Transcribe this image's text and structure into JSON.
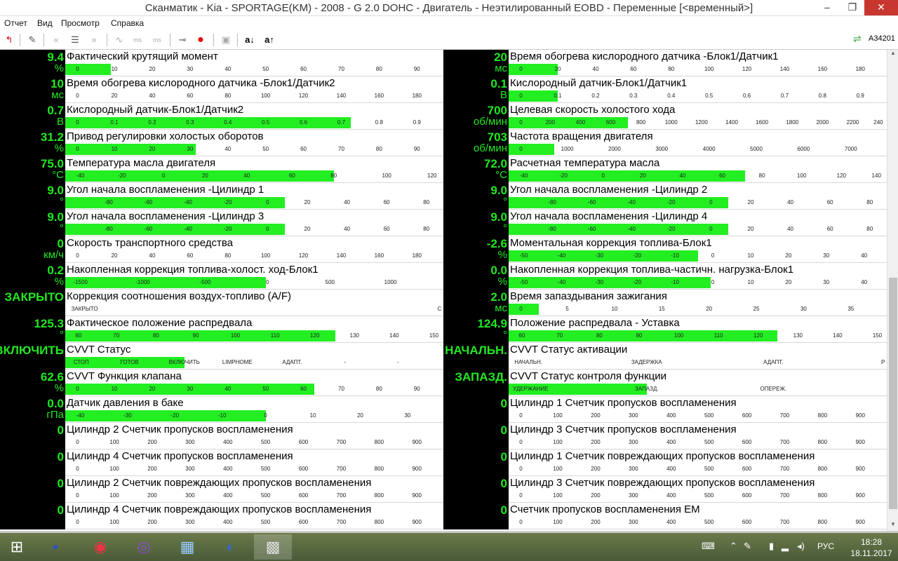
{
  "window": {
    "title": "Сканматик - Kia - SPORTAGE(KM) - 2008 - G 2.0 DOHC - Двигатель - Неэтилированный EOBD - Переменные [<временный>]",
    "min": "–",
    "max": "❐",
    "close": "✕"
  },
  "menu": [
    "Отчет",
    "Вид",
    "Просмотр",
    "Справка"
  ],
  "toolbar": {
    "device_id": "A34201"
  },
  "left": [
    {
      "value": "9.4",
      "unit": "%",
      "label": "Фактический крутящий момент",
      "fill": 0.12,
      "ticks": [
        "0",
        "10",
        "20",
        "30",
        "40",
        "50",
        "60",
        "70",
        "80",
        "90"
      ],
      "tickpos": [
        0.03,
        0.13,
        0.23,
        0.33,
        0.43,
        0.53,
        0.63,
        0.73,
        0.83,
        0.93
      ]
    },
    {
      "value": "10",
      "unit": "мс",
      "label": "Время обогрева кислородного датчика -Блок1/Датчик2",
      "fill": 0.0,
      "ticks": [
        "0",
        "20",
        "40",
        "60",
        "80",
        "100",
        "120",
        "140",
        "160",
        "180"
      ],
      "tickpos": [
        0.03,
        0.13,
        0.23,
        0.33,
        0.43,
        0.53,
        0.63,
        0.73,
        0.83,
        0.93
      ]
    },
    {
      "value": "0.7",
      "unit": "В",
      "label": "Кислородный датчик-Блок1/Датчик2",
      "fill": 0.756,
      "ticks": [
        "0",
        "0.1",
        "0.2",
        "0.3",
        "0.4",
        "0.5",
        "0.6",
        "0.7",
        "0.8",
        "0.9"
      ],
      "tickpos": [
        0.03,
        0.13,
        0.23,
        0.33,
        0.43,
        0.53,
        0.63,
        0.73,
        0.83,
        0.93
      ]
    },
    {
      "value": "31.2",
      "unit": "%",
      "label": "Привод регулировки холостых оборотов",
      "fill": 0.345,
      "ticks": [
        "0",
        "10",
        "20",
        "30",
        "40",
        "50",
        "60",
        "70",
        "80",
        "90"
      ],
      "tickpos": [
        0.03,
        0.13,
        0.23,
        0.33,
        0.43,
        0.53,
        0.63,
        0.73,
        0.83,
        0.93
      ]
    },
    {
      "value": "75.0",
      "unit": "°C",
      "label": "Температура масла двигателя",
      "fill": 0.71,
      "ticks": [
        "-40",
        "-20",
        "0",
        "20",
        "40",
        "60",
        "80",
        "100",
        "120"
      ],
      "tickpos": [
        0.04,
        0.15,
        0.26,
        0.37,
        0.48,
        0.6,
        0.71,
        0.85,
        0.97
      ]
    },
    {
      "value": "9.0",
      "unit": "°",
      "label": "Угол начала воспламенения -Цилиндр 1",
      "fill": 0.58,
      "ticks": [
        "-80",
        "-60",
        "-40",
        "-20",
        "0",
        "20",
        "40",
        "60",
        "80"
      ],
      "tickpos": [
        0.115,
        0.22,
        0.325,
        0.43,
        0.535,
        0.64,
        0.745,
        0.85,
        0.955
      ]
    },
    {
      "value": "9.0",
      "unit": "°",
      "label": "Угол начала воспламенения -Цилиндр 3",
      "fill": 0.58,
      "ticks": [
        "-80",
        "-60",
        "-40",
        "-20",
        "0",
        "20",
        "40",
        "60",
        "80"
      ],
      "tickpos": [
        0.115,
        0.22,
        0.325,
        0.43,
        0.535,
        0.64,
        0.745,
        0.85,
        0.955
      ]
    },
    {
      "value": "0",
      "unit": "км/ч",
      "label": "Скорость транспортного средства",
      "fill": 0.0,
      "ticks": [
        "0",
        "20",
        "40",
        "60",
        "80",
        "100",
        "120",
        "140",
        "160",
        "180"
      ],
      "tickpos": [
        0.03,
        0.13,
        0.23,
        0.33,
        0.43,
        0.53,
        0.63,
        0.73,
        0.83,
        0.93
      ]
    },
    {
      "value": "0.2",
      "unit": "%",
      "label": "Накопленная коррекция топлива-холост. ход-Блок1",
      "fill": 0.53,
      "ticks": [
        "-1500",
        "-1000",
        "-500",
        "0",
        "500",
        "1000"
      ],
      "tickpos": [
        0.04,
        0.205,
        0.37,
        0.535,
        0.7,
        0.86
      ]
    },
    {
      "value": "ЗАКРЫТО",
      "unit": "",
      "label": "Коррекция соотношения воздух-топливо (A/F)",
      "fill": 0.0,
      "ticks": [
        "ЗАКРЫТО",
        "С"
      ],
      "tickpos": [
        0.03,
        0.995
      ]
    },
    {
      "value": "125.3",
      "unit": "°",
      "label": "Фактическое положение распредвала",
      "fill": 0.715,
      "ticks": [
        "60",
        "70",
        "80",
        "90",
        "100",
        "110",
        "120",
        "130",
        "140",
        "150"
      ],
      "tickpos": [
        0.03,
        0.135,
        0.24,
        0.345,
        0.45,
        0.555,
        0.66,
        0.765,
        0.87,
        0.975
      ]
    },
    {
      "value": "ВКЛЮЧИТЬ",
      "unit": "",
      "label": "CVVT Статус",
      "fill": 0.315,
      "ticks": [
        "СТОП",
        "ГОТОВ",
        "ВКЛЮЧИТЬ",
        "LIMPHOME",
        "АДАПТ.",
        "-",
        "-"
      ],
      "tickpos": [
        0.03,
        0.17,
        0.315,
        0.455,
        0.6,
        0.74,
        0.88
      ]
    },
    {
      "value": "62.6",
      "unit": "%",
      "label": "CVVT Функция клапана",
      "fill": 0.658,
      "ticks": [
        "0",
        "10",
        "20",
        "30",
        "40",
        "50",
        "60",
        "70",
        "80",
        "90"
      ],
      "tickpos": [
        0.03,
        0.13,
        0.23,
        0.33,
        0.43,
        0.53,
        0.63,
        0.73,
        0.83,
        0.93
      ]
    },
    {
      "value": "0.0",
      "unit": "гПа",
      "label": "Датчик давления в баке",
      "fill": 0.53,
      "ticks": [
        "-40",
        "-30",
        "-20",
        "-10",
        "0",
        "10",
        "20",
        "30"
      ],
      "tickpos": [
        0.04,
        0.165,
        0.29,
        0.415,
        0.53,
        0.655,
        0.78,
        0.905
      ]
    },
    {
      "value": "0",
      "unit": "",
      "label": "Цилиндр 2 Счетчик пропусков воспламенения",
      "fill": 0.0,
      "ticks": [
        "0",
        "100",
        "200",
        "300",
        "400",
        "500",
        "600",
        "700",
        "800",
        "900"
      ],
      "tickpos": [
        0.03,
        0.13,
        0.23,
        0.33,
        0.43,
        0.53,
        0.63,
        0.73,
        0.83,
        0.93
      ]
    },
    {
      "value": "0",
      "unit": "",
      "label": "Цилиндр 4 Счетчик пропусков воспламенения",
      "fill": 0.0,
      "ticks": [
        "0",
        "100",
        "200",
        "300",
        "400",
        "500",
        "600",
        "700",
        "800",
        "900"
      ],
      "tickpos": [
        0.03,
        0.13,
        0.23,
        0.33,
        0.43,
        0.53,
        0.63,
        0.73,
        0.83,
        0.93
      ]
    },
    {
      "value": "0",
      "unit": "",
      "label": "Цилиндр 2 Счетчик повреждающих пропусков воспламенения",
      "fill": 0.0,
      "ticks": [
        "0",
        "100",
        "200",
        "300",
        "400",
        "500",
        "600",
        "700",
        "800",
        "900"
      ],
      "tickpos": [
        0.03,
        0.13,
        0.23,
        0.33,
        0.43,
        0.53,
        0.63,
        0.73,
        0.83,
        0.93
      ]
    },
    {
      "value": "0",
      "unit": "",
      "label": "Цилиндр 4 Счетчик повреждающих пропусков воспламенения",
      "fill": 0.0,
      "ticks": [
        "0",
        "100",
        "200",
        "300",
        "400",
        "500",
        "600",
        "700",
        "800",
        "900"
      ],
      "tickpos": [
        0.03,
        0.13,
        0.23,
        0.33,
        0.43,
        0.53,
        0.63,
        0.73,
        0.83,
        0.93
      ]
    }
  ],
  "right": [
    {
      "value": "20",
      "unit": "мс",
      "label": "Время обогрева кислородного датчика -Блок1/Датчик1",
      "fill": 0.13,
      "ticks": [
        "0",
        "20",
        "40",
        "60",
        "80",
        "100",
        "120",
        "140",
        "160",
        "180"
      ],
      "tickpos": [
        0.03,
        0.13,
        0.23,
        0.33,
        0.43,
        0.53,
        0.63,
        0.73,
        0.83,
        0.93
      ]
    },
    {
      "value": "0.1",
      "unit": "В",
      "label": "Кислородный датчик-Блок1/Датчик1",
      "fill": 0.13,
      "ticks": [
        "0",
        "0.1",
        "0.2",
        "0.3",
        "0.4",
        "0.5",
        "0.6",
        "0.7",
        "0.8",
        "0.9"
      ],
      "tickpos": [
        0.03,
        0.13,
        0.23,
        0.33,
        0.43,
        0.53,
        0.63,
        0.73,
        0.83,
        0.93
      ]
    },
    {
      "value": "700",
      "unit": "об/мин",
      "label": "Целевая скорость холостого хода",
      "fill": 0.315,
      "ticks": [
        "0",
        "200",
        "400",
        "600",
        "800",
        "1000",
        "1200",
        "1400",
        "1600",
        "1800",
        "2000",
        "2200",
        "240"
      ],
      "tickpos": [
        0.03,
        0.11,
        0.19,
        0.27,
        0.35,
        0.43,
        0.51,
        0.59,
        0.67,
        0.75,
        0.83,
        0.91,
        0.99
      ]
    },
    {
      "value": "703",
      "unit": "об/мин",
      "label": "Частота вращения двигателя",
      "fill": 0.12,
      "ticks": [
        "0",
        "1000",
        "2000",
        "3000",
        "4000",
        "5000",
        "6000",
        "7000"
      ],
      "tickpos": [
        0.03,
        0.155,
        0.28,
        0.405,
        0.53,
        0.655,
        0.78,
        0.905
      ]
    },
    {
      "value": "72.0",
      "unit": "°C",
      "label": "Расчетная температура масла",
      "fill": 0.625,
      "ticks": [
        "-40",
        "-20",
        "0",
        "20",
        "40",
        "60",
        "80",
        "100",
        "120",
        "140"
      ],
      "tickpos": [
        0.04,
        0.145,
        0.25,
        0.355,
        0.46,
        0.565,
        0.67,
        0.775,
        0.88,
        0.985
      ]
    },
    {
      "value": "9.0",
      "unit": "°",
      "label": "Угол начала воспламенения -Цилиндр 2",
      "fill": 0.58,
      "ticks": [
        "-80",
        "-60",
        "-40",
        "-20",
        "0",
        "20",
        "40",
        "60",
        "80"
      ],
      "tickpos": [
        0.115,
        0.22,
        0.325,
        0.43,
        0.535,
        0.64,
        0.745,
        0.85,
        0.955
      ]
    },
    {
      "value": "9.0",
      "unit": "°",
      "label": "Угол начала воспламенения -Цилиндр 4",
      "fill": 0.58,
      "ticks": [
        "-80",
        "-60",
        "-40",
        "-20",
        "0",
        "20",
        "40",
        "60",
        "80"
      ],
      "tickpos": [
        0.115,
        0.22,
        0.325,
        0.43,
        0.535,
        0.64,
        0.745,
        0.85,
        0.955
      ]
    },
    {
      "value": "-2.6",
      "unit": "%",
      "label": "Моментальная коррекция топлива-Блок1",
      "fill": 0.5,
      "ticks": [
        "-50",
        "-40",
        "-30",
        "-20",
        "-10",
        "0",
        "10",
        "20",
        "30",
        "40"
      ],
      "tickpos": [
        0.04,
        0.14,
        0.24,
        0.34,
        0.44,
        0.54,
        0.64,
        0.74,
        0.84,
        0.94
      ]
    },
    {
      "value": "0.0",
      "unit": "%",
      "label": "Накопленная коррекция топлива-частичн. нагрузка-Блок1",
      "fill": 0.535,
      "ticks": [
        "-50",
        "-40",
        "-30",
        "-20",
        "-10",
        "0",
        "10",
        "20",
        "30",
        "40"
      ],
      "tickpos": [
        0.04,
        0.14,
        0.24,
        0.34,
        0.44,
        0.54,
        0.64,
        0.74,
        0.84,
        0.94
      ]
    },
    {
      "value": "2.0",
      "unit": "мс",
      "label": "Время запаздывания зажигания",
      "fill": 0.08,
      "ticks": [
        "0",
        "5",
        "10",
        "15",
        "20",
        "25",
        "30",
        "35"
      ],
      "tickpos": [
        0.03,
        0.155,
        0.28,
        0.405,
        0.53,
        0.655,
        0.78,
        0.905
      ]
    },
    {
      "value": "124.9",
      "unit": "°",
      "label": "Положение распредвала - Уставка",
      "fill": 0.71,
      "ticks": [
        "60",
        "70",
        "80",
        "90",
        "100",
        "110",
        "120",
        "130",
        "140",
        "150"
      ],
      "tickpos": [
        0.03,
        0.135,
        0.24,
        0.345,
        0.45,
        0.555,
        0.66,
        0.765,
        0.87,
        0.975
      ]
    },
    {
      "value": "НАЧАЛЬН.",
      "unit": "",
      "label": "CVVT Статус активации",
      "fill": 0.0,
      "ticks": [
        "НАЧАЛЬН.",
        "ЗАДЕРЖКА",
        "АДАПТ.",
        "Р"
      ],
      "tickpos": [
        0.03,
        0.365,
        0.7,
        0.995
      ]
    },
    {
      "value": "ЗАПАЗД.",
      "unit": "",
      "label": "CVVT Статус контроля функции",
      "fill": 0.365,
      "ticks": [
        "УДЕРЖАНИЕ",
        "ЗАПАЗД.",
        "ОПЕРЕЖ."
      ],
      "tickpos": [
        0.03,
        0.365,
        0.7
      ]
    },
    {
      "value": "0",
      "unit": "",
      "label": "Цилиндр 1 Счетчик пропусков воспламенения",
      "fill": 0.0,
      "ticks": [
        "0",
        "100",
        "200",
        "300",
        "400",
        "500",
        "600",
        "700",
        "800",
        "900"
      ],
      "tickpos": [
        0.03,
        0.13,
        0.23,
        0.33,
        0.43,
        0.53,
        0.63,
        0.73,
        0.83,
        0.93
      ]
    },
    {
      "value": "0",
      "unit": "",
      "label": "Цилиндр 3 Счетчик пропусков воспламенения",
      "fill": 0.0,
      "ticks": [
        "0",
        "100",
        "200",
        "300",
        "400",
        "500",
        "600",
        "700",
        "800",
        "900"
      ],
      "tickpos": [
        0.03,
        0.13,
        0.23,
        0.33,
        0.43,
        0.53,
        0.63,
        0.73,
        0.83,
        0.93
      ]
    },
    {
      "value": "0",
      "unit": "",
      "label": "Цилиндр 1 Счетчик повреждающих пропусков воспламенения",
      "fill": 0.0,
      "ticks": [
        "0",
        "100",
        "200",
        "300",
        "400",
        "500",
        "600",
        "700",
        "800",
        "900"
      ],
      "tickpos": [
        0.03,
        0.13,
        0.23,
        0.33,
        0.43,
        0.53,
        0.63,
        0.73,
        0.83,
        0.93
      ]
    },
    {
      "value": "0",
      "unit": "",
      "label": "Цилиндр 3 Счетчик повреждающих пропусков воспламенения",
      "fill": 0.0,
      "ticks": [
        "0",
        "100",
        "200",
        "300",
        "400",
        "500",
        "600",
        "700",
        "800",
        "900"
      ],
      "tickpos": [
        0.03,
        0.13,
        0.23,
        0.33,
        0.43,
        0.53,
        0.63,
        0.73,
        0.83,
        0.93
      ]
    },
    {
      "value": "0",
      "unit": "",
      "label": "Счетчик пропусков воспламенения ЕМ",
      "fill": 0.0,
      "ticks": [
        "0",
        "100",
        "200",
        "300",
        "400",
        "500",
        "600",
        "700",
        "800",
        "900"
      ],
      "tickpos": [
        0.03,
        0.13,
        0.23,
        0.33,
        0.43,
        0.53,
        0.63,
        0.73,
        0.83,
        0.93
      ]
    }
  ],
  "taskbar": {
    "lang": "РУС",
    "time": "18:28",
    "date": "18.11.2017"
  }
}
